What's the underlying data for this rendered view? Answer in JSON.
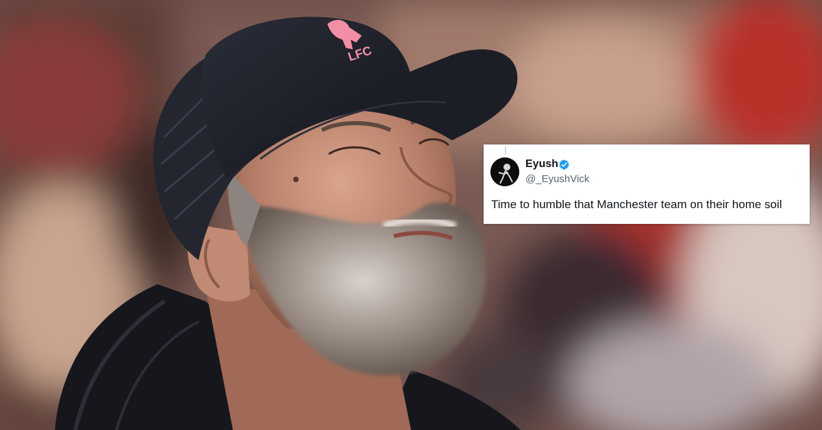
{
  "tweet": {
    "display_name": "Eyush",
    "handle": "@_EyushVick",
    "text": "Time to humble that Manchester team on their home soil",
    "verified": true,
    "verified_color": "#1d9bf0",
    "avatar_icon": "silhouette-avatar"
  },
  "photo": {
    "cap_logo_text": "LFC",
    "cap_logo_icon": "liverbird-icon",
    "cap_logo_color": "#f28fa6",
    "cap_color": "#1a1c24"
  }
}
